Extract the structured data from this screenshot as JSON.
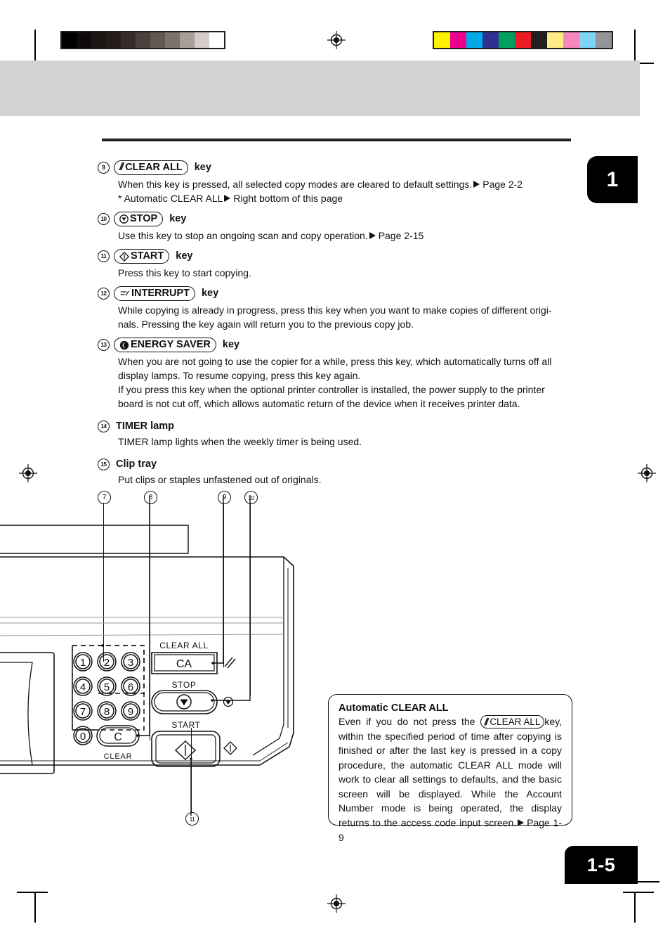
{
  "document": {
    "chapter_tab": "1",
    "page_tab": "1-5"
  },
  "calibration": {
    "grayscale_label": "grayscale-step-wedge",
    "grayscale_swatches": [
      "#000000",
      "#0d0a09",
      "#1b1513",
      "#241d1a",
      "#362d29",
      "#4b413d",
      "#625751",
      "#7d726c",
      "#a89e99",
      "#d4ccc8",
      "#ffffff"
    ],
    "color_label": "color-control-patches",
    "color_swatches": [
      "#fff200",
      "#ec008c",
      "#00a9e7",
      "#2e3192",
      "#00a160",
      "#ed1c24",
      "#231f20",
      "#fdec86",
      "#f589bd",
      "#7fd3f5",
      "#939598"
    ]
  },
  "entries": [
    {
      "num": "9",
      "key": {
        "type": "capsule",
        "glyph": "slashes",
        "label": "CLEAR ALL"
      },
      "suffix": "key",
      "lines": [
        "When this key is pressed, all selected copy modes are cleared to default settings.",
        "Page 2-2",
        "* Automatic CLEAR ALL",
        "Right bottom of this page"
      ]
    },
    {
      "num": "10",
      "key": {
        "type": "capsule",
        "glyph": "stop",
        "label": "STOP"
      },
      "suffix": "key",
      "lines": [
        "Use this key to stop an ongoing scan and copy operation.",
        "Page 2-15"
      ]
    },
    {
      "num": "11",
      "key": {
        "type": "capsule",
        "glyph": "start",
        "label": "START"
      },
      "suffix": "key",
      "lines": [
        "Press this key to start copying."
      ]
    },
    {
      "num": "12",
      "key": {
        "type": "capsule",
        "glyph": "interrupt",
        "label": "INTERRUPT"
      },
      "suffix": "key",
      "lines": [
        "While copying is already in progress, press this key when you want to make copies of different origi-",
        "nals.   Pressing the key again will return you to the previous copy job."
      ]
    },
    {
      "num": "13",
      "key": {
        "type": "capsule",
        "glyph": "energy",
        "label": "ENERGY SAVER"
      },
      "suffix": "key",
      "lines": [
        "When you are not going to use the copier for a while, press this key, which automatically turns off all",
        "display lamps.  To resume copying, press this key again.",
        "If you press this key when the optional printer controller is installed, the power supply to the printer",
        "board is not cut off, which allows automatic return of the device when it receives printer data."
      ]
    },
    {
      "num": "14",
      "key": {
        "type": "plain",
        "label": "TIMER lamp"
      },
      "suffix": "",
      "lines": [
        "TIMER lamp lights when the weekly timer is being used."
      ]
    },
    {
      "num": "15",
      "key": {
        "type": "plain",
        "label": "Clip tray"
      },
      "suffix": "",
      "lines": [
        "Put clips or staples unfastened out of originals."
      ]
    }
  ],
  "entry_text": {
    "e9_l1": "When this key is pressed, all selected copy modes are cleared to default settings.",
    "e9_ref1": "Page 2-2",
    "e9_l2": "* Automatic CLEAR ALL",
    "e9_ref2": "Right bottom of this page",
    "e10_l1": "Use this key to stop an ongoing scan and copy operation.",
    "e10_ref1": "Page 2-15",
    "e11_l1": "Press this key to start copying.",
    "e12_l1": "While copying is already in progress, press this key when you want to make copies of different origi-",
    "e12_l2": "nals.   Pressing the key again will return you to the previous copy job.",
    "e13_l1": "When you are not going to use the copier for a while, press this key, which automatically turns off all",
    "e13_l2": "display lamps.  To resume copying, press this key again.",
    "e13_l3": "If you press this key when the optional printer controller is installed, the power supply to the printer",
    "e13_l4": "board is not cut off, which allows automatic return of the device when it receives printer data.",
    "e14_l1": "TIMER lamp lights when the weekly timer is being used.",
    "e15_l1": "Put clips or staples unfastened out of originals."
  },
  "key_labels": {
    "clear_all": "CLEAR ALL",
    "stop": "STOP",
    "start": "START",
    "interrupt": "INTERRUPT",
    "energy_saver": "ENERGY SAVER",
    "timer_lamp": "TIMER lamp",
    "clip_tray": "Clip tray",
    "key_word": "key"
  },
  "numbers": {
    "n9": "9",
    "n10": "10",
    "n11": "11",
    "n12": "12",
    "n13": "13",
    "n14": "14",
    "n15": "15"
  },
  "callouts": {
    "c7": "7",
    "c8": "8",
    "c9": "9",
    "c10": "10",
    "c11": "11"
  },
  "illustration": {
    "name": "copier-operation-panel-diagram",
    "keypad_digits": [
      "1",
      "2",
      "3",
      "4",
      "5",
      "6",
      "7",
      "8",
      "9",
      "0"
    ],
    "clear_key": "C",
    "clear_key_label": "CLEAR",
    "clear_all_label": "CLEAR ALL",
    "clear_all_button": "CA",
    "stop_label": "STOP",
    "start_label": "START"
  },
  "note": {
    "title": "Automatic CLEAR ALL",
    "before_key": "Even if you do not press the",
    "key_glyph_label": "CLEAR ALL",
    "after_key": "key, within the specified period of time after copying is finished or after the last key is pressed in a copy procedure, the automatic CLEAR ALL mode will work to clear all settings to defaults, and the basic screen will be displayed. While the Account Number mode is being operated, the display returns to the access code input screen.",
    "reference": "Page 1-9"
  }
}
